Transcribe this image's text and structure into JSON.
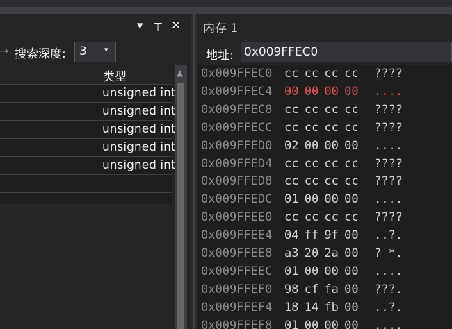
{
  "watch_panel": {
    "toolbar": {
      "depth_label": "搜索深度:",
      "depth_value": "3"
    },
    "columns": {
      "type": "类型"
    },
    "rows": [
      {
        "type": "unsigned int"
      },
      {
        "type": "unsigned int"
      },
      {
        "type": "unsigned int"
      },
      {
        "type": "unsigned int"
      },
      {
        "type": "unsigned int"
      },
      {
        "type": ""
      }
    ]
  },
  "memory_panel": {
    "title": "内存 1",
    "address_label": "地址:",
    "address_value": "0x009FFEC0",
    "highlight_color": "#e05252",
    "rows": [
      {
        "address": "0x009FFEC0",
        "bytes": "cc cc cc cc",
        "ascii": "????",
        "changed": false
      },
      {
        "address": "0x009FFEC4",
        "bytes": "00 00 00 00",
        "ascii": "....",
        "changed": true
      },
      {
        "address": "0x009FFEC8",
        "bytes": "cc cc cc cc",
        "ascii": "????",
        "changed": false
      },
      {
        "address": "0x009FFECC",
        "bytes": "cc cc cc cc",
        "ascii": "????",
        "changed": false
      },
      {
        "address": "0x009FFED0",
        "bytes": "02 00 00 00",
        "ascii": "....",
        "changed": false
      },
      {
        "address": "0x009FFED4",
        "bytes": "cc cc cc cc",
        "ascii": "????",
        "changed": false
      },
      {
        "address": "0x009FFED8",
        "bytes": "cc cc cc cc",
        "ascii": "????",
        "changed": false
      },
      {
        "address": "0x009FFEDC",
        "bytes": "01 00 00 00",
        "ascii": "....",
        "changed": false
      },
      {
        "address": "0x009FFEE0",
        "bytes": "cc cc cc cc",
        "ascii": "????",
        "changed": false
      },
      {
        "address": "0x009FFEE4",
        "bytes": "04 ff 9f 00",
        "ascii": "..?.",
        "changed": false
      },
      {
        "address": "0x009FFEE8",
        "bytes": "a3 20 2a 00",
        "ascii": "? *.",
        "changed": false
      },
      {
        "address": "0x009FFEEC",
        "bytes": "01 00 00 00",
        "ascii": "....",
        "changed": false
      },
      {
        "address": "0x009FFEF0",
        "bytes": "98 cf fa 00",
        "ascii": "???.",
        "changed": false
      },
      {
        "address": "0x009FFEF4",
        "bytes": "18 14 fb 00",
        "ascii": "..?.",
        "changed": false
      },
      {
        "address": "0x009FFEF8",
        "bytes": "01 00 00 00",
        "ascii": "....",
        "changed": false
      }
    ]
  },
  "icons": {
    "dropdown": "▾",
    "pin": "⊥",
    "close": "✕",
    "arrow": "→",
    "scroll_up": "▲"
  }
}
